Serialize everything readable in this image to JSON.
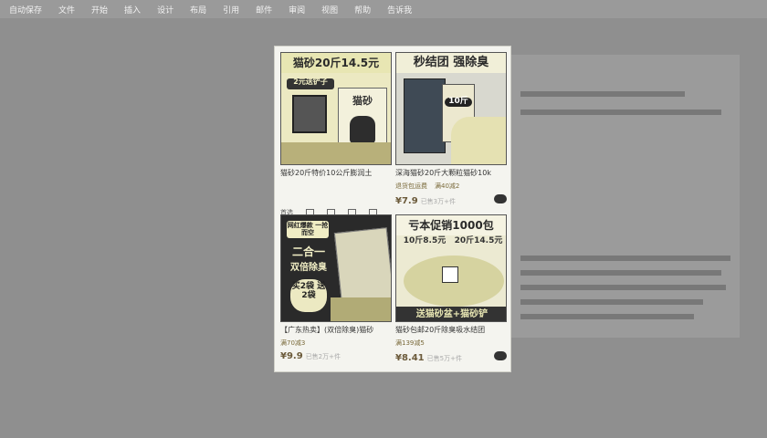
{
  "menu": [
    "自动保存",
    "文件",
    "开始",
    "插入",
    "设计",
    "布局",
    "引用",
    "邮件",
    "审阅",
    "视图",
    "帮助",
    "告诉我"
  ],
  "side_label": "首选",
  "products": [
    {
      "banner": "猫砂20斤14.5元",
      "badge": "2元送铲子",
      "bag_text": "猫砂",
      "name": "猫砂20斤特价10公斤膨润土",
      "promo": [],
      "price": "",
      "sold": ""
    },
    {
      "banner": "秒结团 强除臭",
      "bag_text": "10斤",
      "name": "深海猫砂20斤大颗粒猫砂10k",
      "promo": [
        "退货包运费",
        "满40减2"
      ],
      "price": "¥7.9",
      "sold": "已售3万+件"
    },
    {
      "banner": "",
      "badge": "网红爆款 一抢而空",
      "bag_text": "二合一",
      "sub_text": "双倍除臭",
      "gift": "买2袋 送2袋",
      "name": "【广东热卖】(双倍除臭)猫砂",
      "promo": [
        "满70减3"
      ],
      "price": "¥9.9",
      "sold": "已售2万+件"
    },
    {
      "banner": "亏本促销1000包",
      "price_tag_1": "10斤8.5元",
      "price_tag_2": "20斤14.5元",
      "footer_tag": "送猫砂盆+猫砂铲",
      "name": "猫砂包邮20斤除臭吸水结团",
      "promo": [
        "满139减5"
      ],
      "price": "¥8.41",
      "sold": "已售5万+件"
    }
  ],
  "colors": {
    "page_bg": "#8f8f8f",
    "card_bg": "#f4f4ef",
    "banner_yellow": "#e8e6b3",
    "banner_dark": "#2f2f2f",
    "price": "#6b5a3a"
  }
}
